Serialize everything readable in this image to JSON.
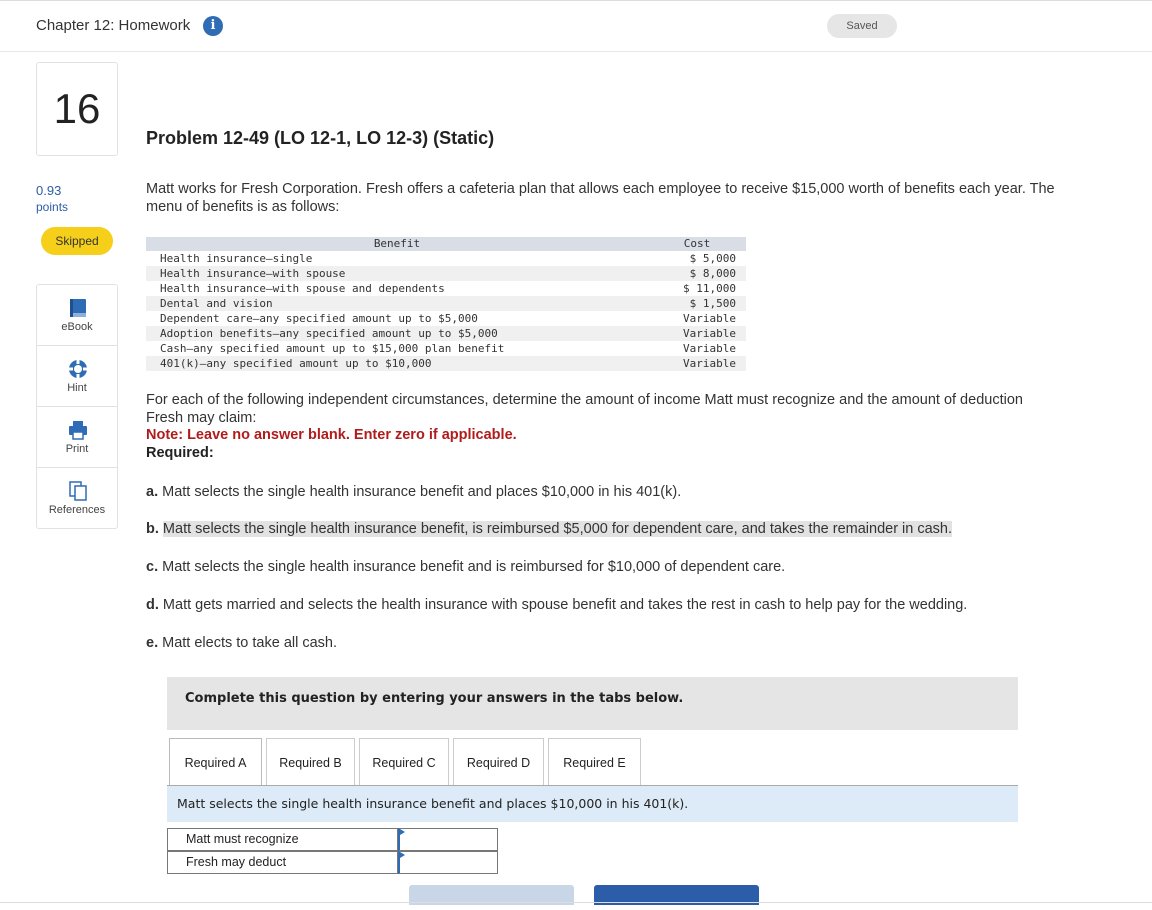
{
  "header": {
    "chapter_title": "Chapter 12: Homework",
    "saved_label": "Saved"
  },
  "sidebar": {
    "question_number": "16",
    "points_value": "0.93",
    "points_label": "points",
    "status_badge": "Skipped",
    "tools": [
      {
        "label": "eBook",
        "icon": "book-icon"
      },
      {
        "label": "Hint",
        "icon": "lifebuoy-icon"
      },
      {
        "label": "Print",
        "icon": "printer-icon"
      },
      {
        "label": "References",
        "icon": "documents-icon"
      }
    ]
  },
  "problem": {
    "title": "Problem 12-49 (LO 12-1, LO 12-3) (Static)",
    "intro": "Matt works for Fresh Corporation. Fresh offers a cafeteria plan that allows each employee to receive $15,000 worth of benefits each year. The menu of benefits is as follows:",
    "benefits_table": {
      "headers": [
        "Benefit",
        "Cost"
      ],
      "rows": [
        [
          "Health insurance–single",
          "$ 5,000"
        ],
        [
          "Health insurance–with spouse",
          "$ 8,000"
        ],
        [
          "Health insurance–with spouse and dependents",
          "$ 11,000"
        ],
        [
          "Dental and vision",
          "$ 1,500"
        ],
        [
          "Dependent care–any specified amount up to $5,000",
          "Variable"
        ],
        [
          "Adoption benefits–any specified amount up to $5,000",
          "Variable"
        ],
        [
          "Cash–any specified amount up to $15,000 plan benefit",
          "Variable"
        ],
        [
          "401(k)–any specified amount up to $10,000",
          "Variable"
        ]
      ]
    },
    "instructions": "For each of the following independent circumstances, determine the amount of income Matt must recognize and the amount of deduction Fresh may claim:",
    "note": "Note: Leave no answer blank. Enter zero if applicable.",
    "required_label": "Required:",
    "items": [
      {
        "letter": "a.",
        "text": "Matt selects the single health insurance benefit and places $10,000 in his 401(k)."
      },
      {
        "letter": "b.",
        "text": "Matt selects the single health insurance benefit, is reimbursed $5,000 for dependent care, and takes the remainder in cash."
      },
      {
        "letter": "c.",
        "text": "Matt selects the single health insurance benefit and is reimbursed for $10,000 of dependent care."
      },
      {
        "letter": "d.",
        "text": "Matt gets married and selects the health insurance with spouse benefit and takes the rest in cash to help pay for the wedding."
      },
      {
        "letter": "e.",
        "text": "Matt elects to take all cash."
      }
    ]
  },
  "answer_area": {
    "complete_prompt": "Complete this question by entering your answers in the tabs below.",
    "tabs": [
      "Required A",
      "Required B",
      "Required C",
      "Required D",
      "Required E"
    ],
    "active_tab": "Required A",
    "description": "Matt selects the single health insurance benefit and places $10,000 in his 401(k).",
    "rows": [
      {
        "label": "Matt must recognize",
        "value": ""
      },
      {
        "label": "Fresh may deduct",
        "value": ""
      }
    ]
  },
  "colors": {
    "accent_blue": "#2f6cb5",
    "skipped_yellow": "#f5cf1a",
    "note_red": "#b01c1c",
    "tab_description_bg": "#ddeaf7"
  }
}
